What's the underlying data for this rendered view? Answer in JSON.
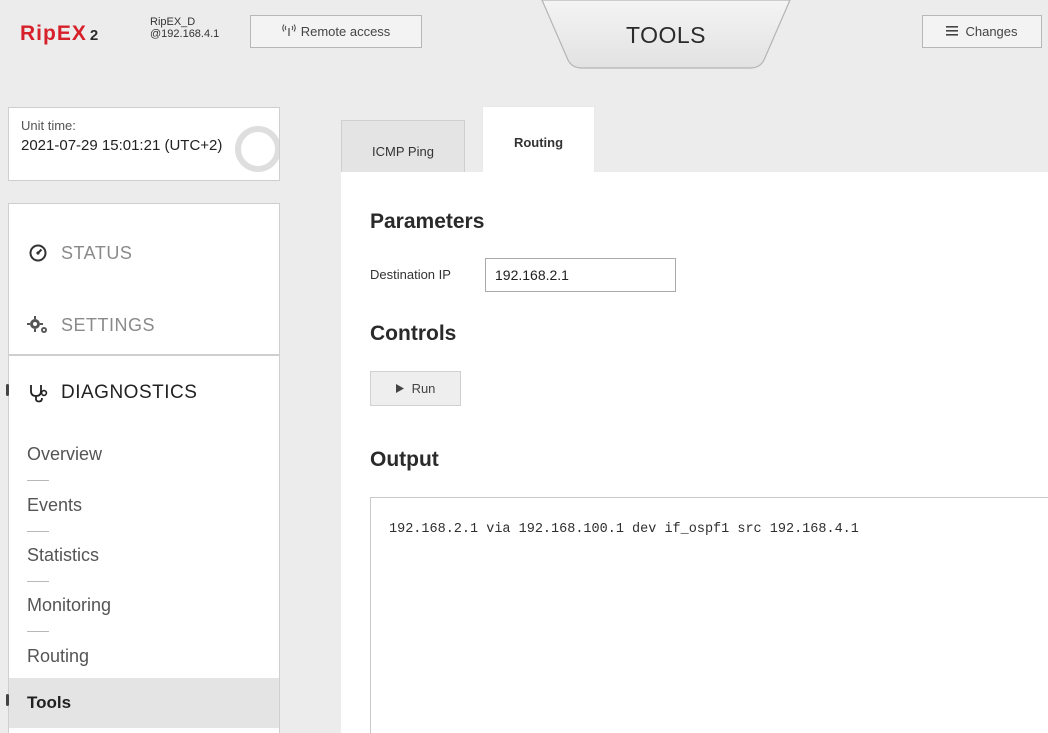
{
  "header": {
    "logo_main": "RipEX",
    "logo_num": "2",
    "unit_name": "RipEX_D",
    "unit_ip": "@192.168.4.1",
    "remote_access_label": "Remote access",
    "page_title": "TOOLS",
    "changes_label": "Changes"
  },
  "unit_time": {
    "label": "Unit time:",
    "value": "2021-07-29 15:01:21 (UTC+2)"
  },
  "nav": {
    "status": "STATUS",
    "settings": "SETTINGS",
    "diagnostics": "DIAGNOSTICS",
    "sub_items": [
      "Overview",
      "Events",
      "Statistics",
      "Monitoring",
      "Routing",
      "Tools"
    ],
    "active_sub_item": "Tools"
  },
  "tabs": [
    {
      "label": "ICMP Ping",
      "active": false
    },
    {
      "label": "Routing",
      "active": true
    }
  ],
  "parameters": {
    "heading": "Parameters",
    "destination_label": "Destination IP",
    "destination_value": "192.168.2.1"
  },
  "controls": {
    "heading": "Controls",
    "run_label": "Run"
  },
  "output": {
    "heading": "Output",
    "text": "192.168.2.1 via 192.168.100.1 dev if_ospf1 src 192.168.4.1"
  },
  "colors": {
    "brand_red": "#d6202a",
    "background": "#ececec",
    "active_nav_bg": "#e4e4e4"
  }
}
